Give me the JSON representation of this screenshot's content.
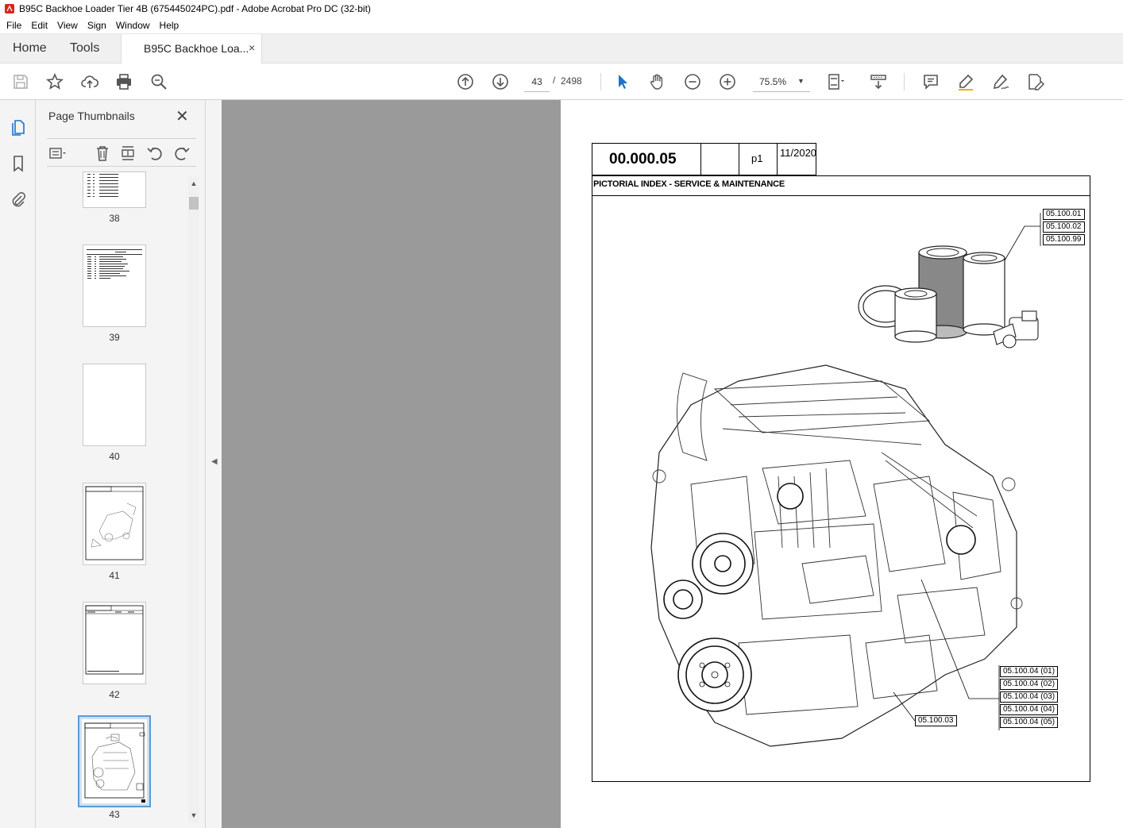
{
  "window": {
    "title": "B95C Backhoe Loader Tier 4B (675445024PC).pdf - Adobe Acrobat Pro DC (32-bit)"
  },
  "menu": [
    "File",
    "Edit",
    "View",
    "Sign",
    "Window",
    "Help"
  ],
  "tabs": {
    "home": "Home",
    "tools": "Tools",
    "document": "B95C Backhoe Loa...",
    "close": "×"
  },
  "toolbar": {
    "current_page": "43",
    "separator": "/",
    "total_pages": "2498",
    "zoom": "75.5%"
  },
  "thumbnails_panel": {
    "title": "Page Thumbnails",
    "close": "✕",
    "pages": [
      "38",
      "39",
      "40",
      "41",
      "42",
      "43"
    ],
    "selected_page": "43"
  },
  "document": {
    "code": "00.000.05",
    "page_label": "p1",
    "date": "11/2020",
    "heading": "PICTORIAL INDEX - SERVICE & MAINTENANCE",
    "refs_top": [
      "05.100.01",
      "05.100.02",
      "05.100.99"
    ],
    "refs_bottom": [
      "05.100.04 (01)",
      "05.100.04 (02)",
      "05.100.04 (03)",
      "05.100.04 (04)",
      "05.100.04 (05)"
    ],
    "ref_engine": "05.100.03"
  },
  "icons": {
    "save": "save-icon",
    "bookmark_star": "star-icon",
    "upload": "upload-cloud-icon",
    "print": "print-icon",
    "search": "zoom-search-icon",
    "prev_page": "arrow-up-circle-icon",
    "next_page": "arrow-down-circle-icon",
    "select": "pointer-icon",
    "hand": "hand-icon",
    "zoom_out": "zoom-out-icon",
    "zoom_in": "zoom-in-icon",
    "fit": "fit-page-icon",
    "scroll": "scroll-mode-icon",
    "comment": "comment-icon",
    "highlight": "highlight-pen-icon",
    "sign": "sign-icon",
    "edit": "edit-pdf-icon"
  },
  "colors": {
    "viewer_background": "#9a9a9a",
    "accent_blue": "#1a73c8",
    "selected_thumb": "#cfe0f1"
  }
}
